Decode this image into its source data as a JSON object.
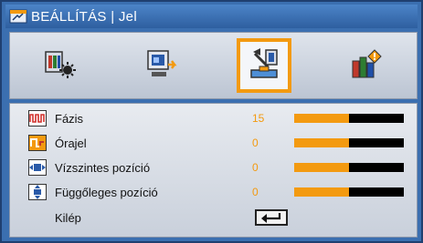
{
  "header": {
    "title": "BEÁLLÍTÁS | Jel",
    "icon": "settings-menu-icon"
  },
  "tabs": [
    {
      "name": "tab-image",
      "icon": "image-settings-icon",
      "active": false
    },
    {
      "name": "tab-display",
      "icon": "display-settings-icon",
      "active": false
    },
    {
      "name": "tab-setup",
      "icon": "setup-settings-icon",
      "active": true
    },
    {
      "name": "tab-options",
      "icon": "options-settings-icon",
      "active": false
    }
  ],
  "items": [
    {
      "label": "Fázis",
      "value": "15",
      "level": 0.5,
      "icon": "phase-icon"
    },
    {
      "label": "Órajel",
      "value": "0",
      "level": 0.5,
      "icon": "clock-icon"
    },
    {
      "label": "Vízszintes pozíció",
      "value": "0",
      "level": 0.5,
      "icon": "horizontal-position-icon"
    },
    {
      "label": "Függőleges pozíció",
      "value": "0",
      "level": 0.5,
      "icon": "vertical-position-icon"
    }
  ],
  "exit": {
    "label": "Kilép",
    "icon": "enter-key-icon"
  },
  "colors": {
    "accent": "#f39a10",
    "title_bg": "#3b6fb0",
    "slider_track": "#000000"
  }
}
